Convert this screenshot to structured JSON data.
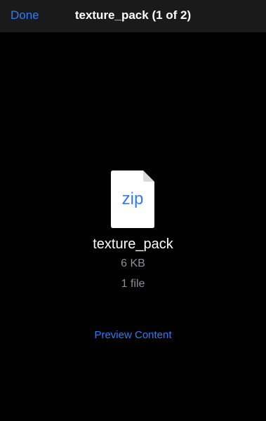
{
  "nav": {
    "done_label": "Done",
    "title": "texture_pack (1 of 2)"
  },
  "file": {
    "icon": "zip-file-icon",
    "extension": "zip",
    "name": "texture_pack",
    "size": "6 KB",
    "count": "1 file"
  },
  "actions": {
    "preview_label": "Preview Content"
  },
  "colors": {
    "background": "#000000",
    "nav_background": "#1a1a1a",
    "accent": "#2f7cf6",
    "secondary_text": "#8e8e93",
    "primary_text": "#ffffff"
  }
}
